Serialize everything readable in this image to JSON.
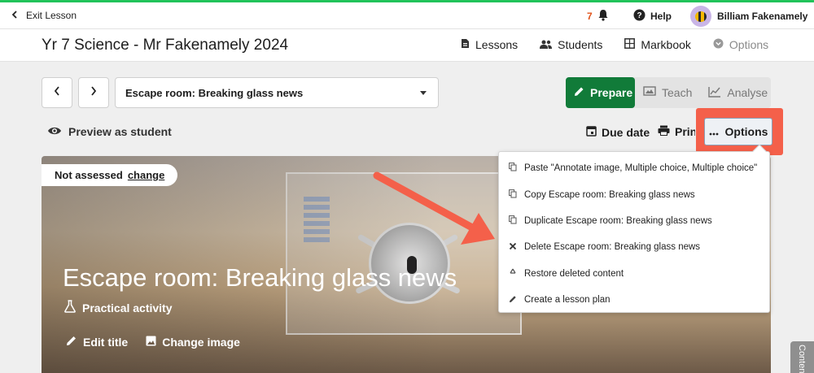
{
  "topbar": {
    "exit_label": "Exit Lesson",
    "notification_count": "7",
    "help_label": "Help",
    "user_name": "Billiam Fakenamely"
  },
  "classbar": {
    "class_title": "Yr 7 Science - Mr Fakenamely 2024",
    "links": {
      "lessons": "Lessons",
      "students": "Students",
      "markbook": "Markbook",
      "options": "Options"
    }
  },
  "lesson_selector": {
    "selected": "Escape room: Breaking glass news"
  },
  "modes": {
    "prepare": "Prepare",
    "teach": "Teach",
    "analyse": "Analyse",
    "active": "prepare"
  },
  "toolbar": {
    "preview_label": "Preview as student",
    "due_label": "Due date",
    "print_label": "Print",
    "options_label": "Options"
  },
  "hero": {
    "assessment_status": "Not assessed",
    "change_label": "change",
    "title": "Escape room: Breaking glass news",
    "activity_type": "Practical activity",
    "edit_title_label": "Edit title",
    "change_image_label": "Change image"
  },
  "options_menu": {
    "items": [
      {
        "label": "Paste \"Annotate image, Multiple choice, Multiple choice\"",
        "icon": "copy-icon"
      },
      {
        "label": "Copy Escape room: Breaking glass news",
        "icon": "copy-icon"
      },
      {
        "label": "Duplicate Escape room: Breaking glass news",
        "icon": "copy-icon"
      },
      {
        "label": "Delete Escape room: Breaking glass news",
        "icon": "close-icon"
      },
      {
        "label": "Restore deleted content",
        "icon": "recycle-icon"
      },
      {
        "label": "Create a lesson plan",
        "icon": "pencil-icon"
      }
    ]
  },
  "side_tab": {
    "label": "Content"
  },
  "colors": {
    "brand_green": "#117b39",
    "top_border_green": "#21c35a",
    "highlight_red": "#f4604a",
    "notification_orange": "#e0531b"
  }
}
